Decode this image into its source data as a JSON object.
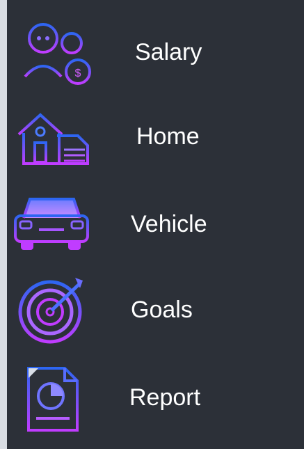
{
  "sidebar": {
    "items": [
      {
        "label": "Salary",
        "icon": "salary-user-icon"
      },
      {
        "label": "Home",
        "icon": "home-icon"
      },
      {
        "label": "Vehicle",
        "icon": "car-icon"
      },
      {
        "label": "Goals",
        "icon": "target-icon"
      },
      {
        "label": "Report",
        "icon": "report-icon"
      }
    ]
  },
  "colors": {
    "background": "#2c3038",
    "icon_blue": "#3a6df0",
    "icon_purple": "#c23cff",
    "label": "#ffffff"
  }
}
